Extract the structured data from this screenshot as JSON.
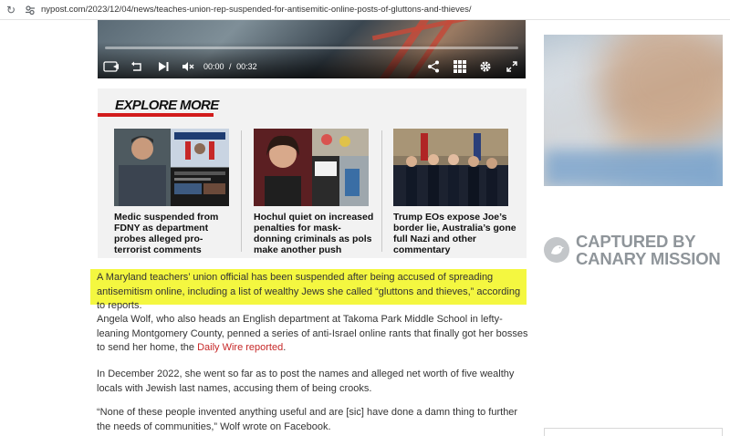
{
  "browser": {
    "url": "nypost.com/2023/12/04/news/teaches-union-rep-suspended-for-antisemitic-online-posts-of-gluttons-and-thieves/"
  },
  "video": {
    "current_time": "00:00",
    "separator": "/",
    "duration": "00:32",
    "progress": 0,
    "icons": [
      "captions-icon",
      "replay-icon",
      "next-icon",
      "mute-icon",
      "share-icon",
      "grid-icon",
      "settings-icon",
      "fullscreen-icon"
    ]
  },
  "explore": {
    "title": "EXPLORE MORE",
    "accent_color": "#d21c1c",
    "cards": [
      {
        "headline": "Medic suspended from FDNY as department probes alleged pro-terrorist comments"
      },
      {
        "headline": "Hochul quiet on increased penalties for mask-donning criminals as pols make another push"
      },
      {
        "headline": "Trump EOs expose Joe’s border lie, Australia’s gone full Nazi and other commentary"
      }
    ]
  },
  "article": {
    "p1": "A Maryland teachers’ union official has been suspended after being accused of spreading antisemitism online, including a list of wealthy Jews she called “gluttons and thieves,” according to reports.",
    "p2_before": "Angela Wolf, who also heads an English department at Takoma Park Middle School in lefty-leaning Montgomery County, penned a series of anti-Israel online rants that finally got her bosses to send her home, the ",
    "p2_link": "Daily Wire reported",
    "p2_after": ".",
    "p3": "In December 2022, she went so far as to post the names and alleged net worth of five wealthy locals with Jewish last names, accusing them of being crooks.",
    "p4": "“None of these people invented anything useful and are [sic] have done a damn thing to further the needs of communities,” Wolf wrote on Facebook.",
    "highlight_color": "#f4f740",
    "link_color": "#c62828"
  },
  "sidebar": {
    "watermark_line1": "CAPTURED BY",
    "watermark_line2": "CANARY MISSION",
    "watermark_color": "#8f959a"
  }
}
